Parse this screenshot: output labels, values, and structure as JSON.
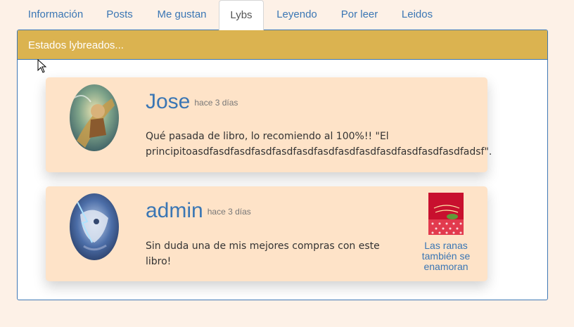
{
  "tabs": [
    {
      "label": "Información"
    },
    {
      "label": "Posts"
    },
    {
      "label": "Me gustan"
    },
    {
      "label": "Lybs"
    },
    {
      "label": "Leyendo"
    },
    {
      "label": "Por leer"
    },
    {
      "label": "Leidos"
    }
  ],
  "active_tab": "Lybs",
  "panel": {
    "heading": "Estados lybreados..."
  },
  "posts": [
    {
      "user": "Jose",
      "time": "hace 3 días",
      "message": "Qué pasada de libro, lo recomiendo al 100%!! \"El principitoasdfasdfasdfasdfasdfasdfasdfasdfasdfasdfasdfasdfasdfadsf\".",
      "avatar_icon": "avatar-warrior-image"
    },
    {
      "user": "admin",
      "time": "hace 3 días",
      "message": "Sin duda una de mis mejores compras con este libro!",
      "avatar_icon": "avatar-beast-image",
      "book": {
        "title": "Las ranas también se enamoran",
        "cover_icon": "book-cover-image"
      }
    }
  ],
  "colors": {
    "background": "#fdf1e7",
    "tab_link": "#3a76b4",
    "panel_heading": "#dbb350",
    "panel_border": "#3f78b5",
    "card": "#fee3c8"
  }
}
